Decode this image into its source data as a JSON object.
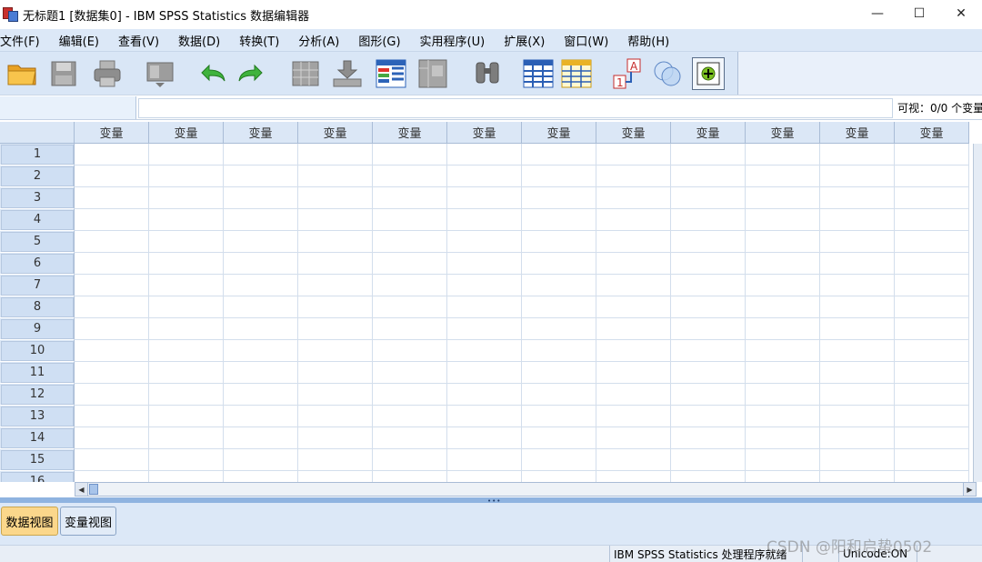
{
  "window": {
    "title": "无标题1 [数据集0] - IBM SPSS Statistics 数据编辑器",
    "controls": {
      "minimize": "—",
      "maximize": "☐",
      "close": "✕"
    }
  },
  "menu": {
    "items": [
      "文件(F)",
      "编辑(E)",
      "查看(V)",
      "数据(D)",
      "转换(T)",
      "分析(A)",
      "图形(G)",
      "实用程序(U)",
      "扩展(X)",
      "窗口(W)",
      "帮助(H)"
    ]
  },
  "toolbar": {
    "icons": [
      "open-folder-icon",
      "save-icon",
      "print-icon",
      "dialog-recall-icon",
      "undo-icon",
      "redo-icon",
      "go-to-case-icon",
      "go-to-variable-icon",
      "variables-icon",
      "split-file-icon",
      "find-icon",
      "insert-cases-icon",
      "insert-variable-icon",
      "value-labels-icon",
      "use-variable-sets-icon",
      "spelling-icon"
    ]
  },
  "editor": {
    "cell_reference": "",
    "cell_value": "",
    "visible_label": "可视：0/0 个变量"
  },
  "grid": {
    "column_headers": [
      "变量",
      "变量",
      "变量",
      "变量",
      "变量",
      "变量",
      "变量",
      "变量",
      "变量",
      "变量",
      "变量",
      "变量"
    ],
    "row_numbers": [
      "1",
      "2",
      "3",
      "4",
      "5",
      "6",
      "7",
      "8",
      "9",
      "10",
      "11",
      "12",
      "13",
      "14",
      "15",
      "16"
    ]
  },
  "tabs": {
    "data_view": "数据视图",
    "variable_view": "变量视图"
  },
  "status": {
    "processor": "IBM SPSS Statistics 处理程序就绪",
    "unicode": "Unicode:ON"
  },
  "watermark": "CSDN @阳和启蛰0502",
  "colors": {
    "menu_bg": "#dce8f7",
    "active_tab": "#fbd78b",
    "header_bg": "#dbe7f6",
    "splitter": "#8fb3e0"
  }
}
